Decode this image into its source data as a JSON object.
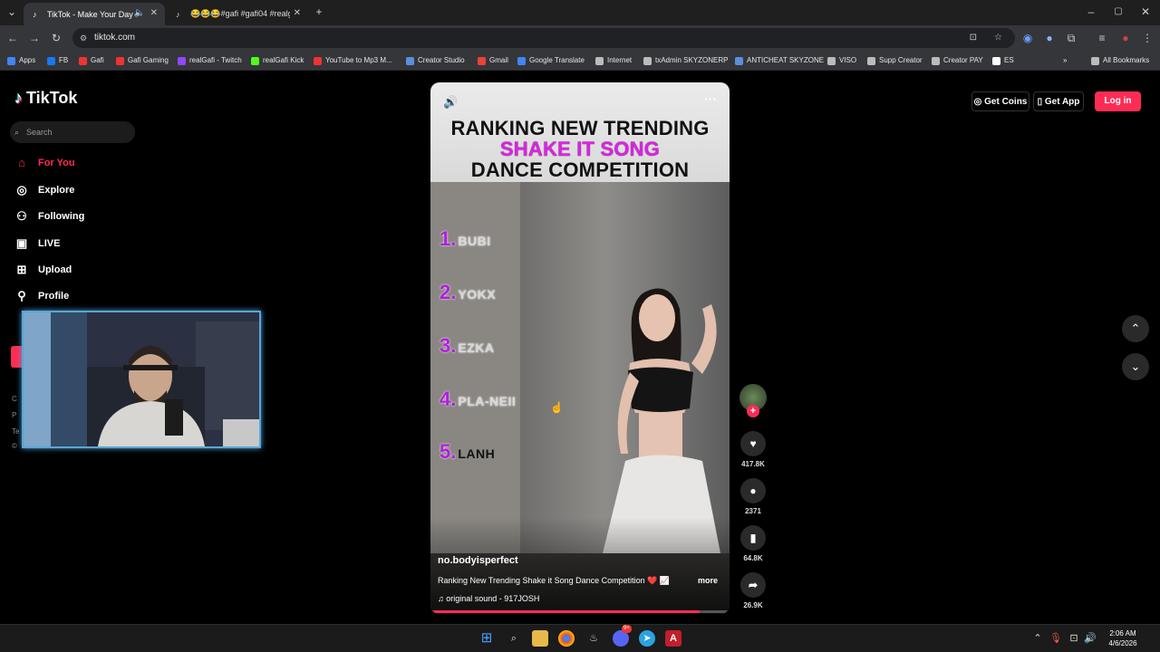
{
  "browser": {
    "tabs": [
      {
        "title": "TikTok - Make Your Day",
        "active": true
      },
      {
        "title": "😂😂😂#gafi #gafi04 #realgafi",
        "active": false
      }
    ],
    "new_tab": "+",
    "window_controls": {
      "minimize": "–",
      "maximize": "▢",
      "close": "✕"
    },
    "url": "tiktok.com",
    "bookmarks": [
      "Apps",
      "FB",
      "Gafi",
      "Gafi Gaming",
      "realGafi - Twitch",
      "realGafi Kick",
      "YouTube to Mp3 M...",
      "Creator Studio",
      "Gmail",
      "Google Translate",
      "Internet",
      "txAdmin SKYZONERP",
      "ANTICHEAT SKYZONE",
      "VISO",
      "Supp Creator",
      "Creator PAY",
      "ES"
    ],
    "all_bookmarks": "All Bookmarks",
    "overflow": "»"
  },
  "tiktok": {
    "logo": "TikTok",
    "search_placeholder": "Search",
    "nav": [
      {
        "label": "For You",
        "icon": "home-icon"
      },
      {
        "label": "Explore",
        "icon": "compass-icon"
      },
      {
        "label": "Following",
        "icon": "following-icon"
      },
      {
        "label": "LIVE",
        "icon": "live-icon"
      },
      {
        "label": "Upload",
        "icon": "upload-icon"
      },
      {
        "label": "Profile",
        "icon": "profile-icon"
      }
    ],
    "footer_partial": [
      "C",
      "P",
      "Te",
      "©"
    ],
    "header": {
      "get_coins": "Get Coins",
      "get_app": "Get App",
      "login": "Log in"
    },
    "video": {
      "title_lines": [
        "RANKING NEW TRENDING",
        "SHAKE IT SONG",
        "DANCE COMPETITION"
      ],
      "ranking": [
        {
          "num": "1.",
          "name": "BUBI"
        },
        {
          "num": "2.",
          "name": "YOKX"
        },
        {
          "num": "3.",
          "name": "EZKA"
        },
        {
          "num": "4.",
          "name": "PLA-NEII"
        },
        {
          "num": "5.",
          "name": "LANH"
        }
      ],
      "author": "no.bodyisperfect",
      "caption": "Ranking New Trending Shake it Song Dance Competition ❤️ 📈",
      "more": "more",
      "sound": "original sound - 917JOSH",
      "progress": 0.9
    },
    "actions": {
      "likes": "417.8K",
      "comments": "2371",
      "saves": "64.8K",
      "shares": "26.9K"
    }
  },
  "taskbar": {
    "time": "2:06 AM",
    "date": "4/6/2026",
    "discord_badge": "9+"
  },
  "colors": {
    "accent": "#fe2c55",
    "ranking": "#b31de0",
    "title_pink": "#e020e8"
  }
}
